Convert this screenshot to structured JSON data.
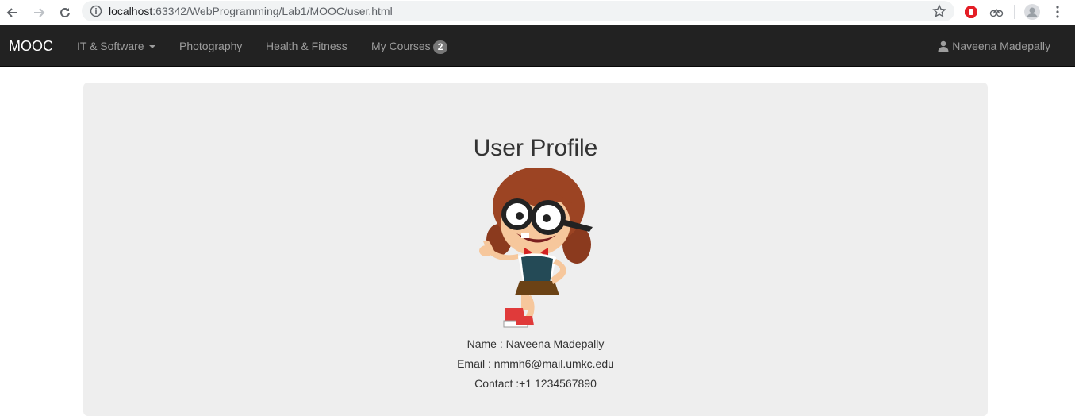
{
  "browser": {
    "url_host": "localhost",
    "url_path": ":63342/WebProgramming/Lab1/MOOC/user.html"
  },
  "navbar": {
    "brand": "MOOC",
    "items": [
      {
        "label": "IT & Software"
      },
      {
        "label": "Photography"
      },
      {
        "label": "Health & Fitness"
      },
      {
        "label": "My Courses",
        "badge": "2"
      }
    ],
    "user": "Naveena Madepally"
  },
  "profile": {
    "title": "User Profile",
    "name_line": "Name : Naveena Madepally",
    "email_line": "Email : nmmh6@mail.umkc.edu",
    "contact_line": "Contact :+1 1234567890"
  },
  "colors": {
    "navbar_bg": "#222222",
    "jumbotron_bg": "#eeeeee",
    "badge_bg": "#777777"
  }
}
